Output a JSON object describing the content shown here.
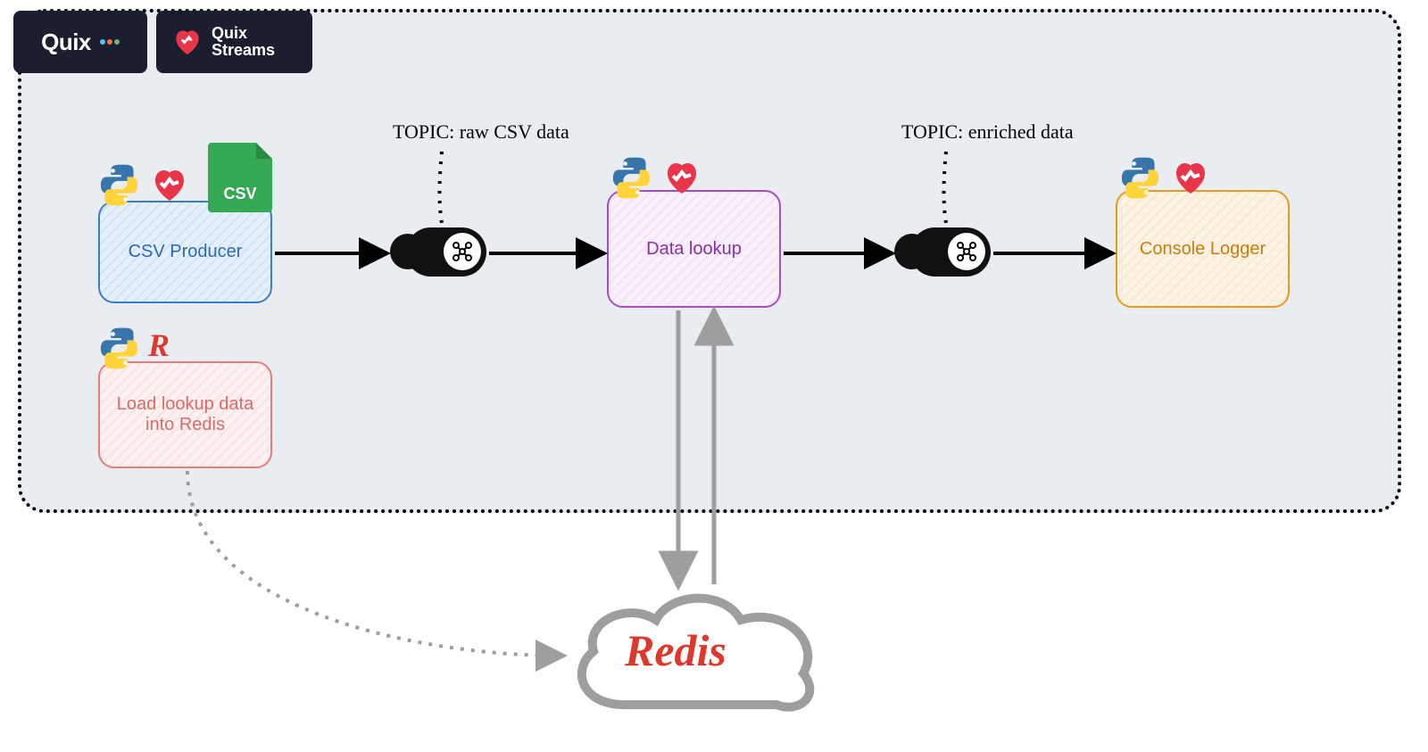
{
  "logos": {
    "quix": "Quix",
    "quix_streams_line1": "Quix",
    "quix_streams_line2": "Streams"
  },
  "nodes": {
    "csv_producer": "CSV Producer",
    "data_lookup": "Data lookup",
    "console_logger": "Console Logger",
    "load_lookup": "Load lookup data into Redis"
  },
  "topics": {
    "raw": "TOPIC: raw CSV data",
    "enriched": "TOPIC: enriched data"
  },
  "icons": {
    "csv_file": "CSV",
    "redis_cloud": "Redis",
    "redis_r": "R",
    "python": "python-icon",
    "heart": "quix-heart-icon",
    "kafka": "kafka-icon"
  },
  "colors": {
    "container_bg": "#e9edf1",
    "blue": "#3a7ec9",
    "purple": "#a84bc9",
    "orange": "#e69a1e",
    "red": "#e87b7b",
    "redis": "#dc382c",
    "python_blue": "#3776ab",
    "python_yellow": "#ffd43b",
    "green": "#34a853"
  }
}
